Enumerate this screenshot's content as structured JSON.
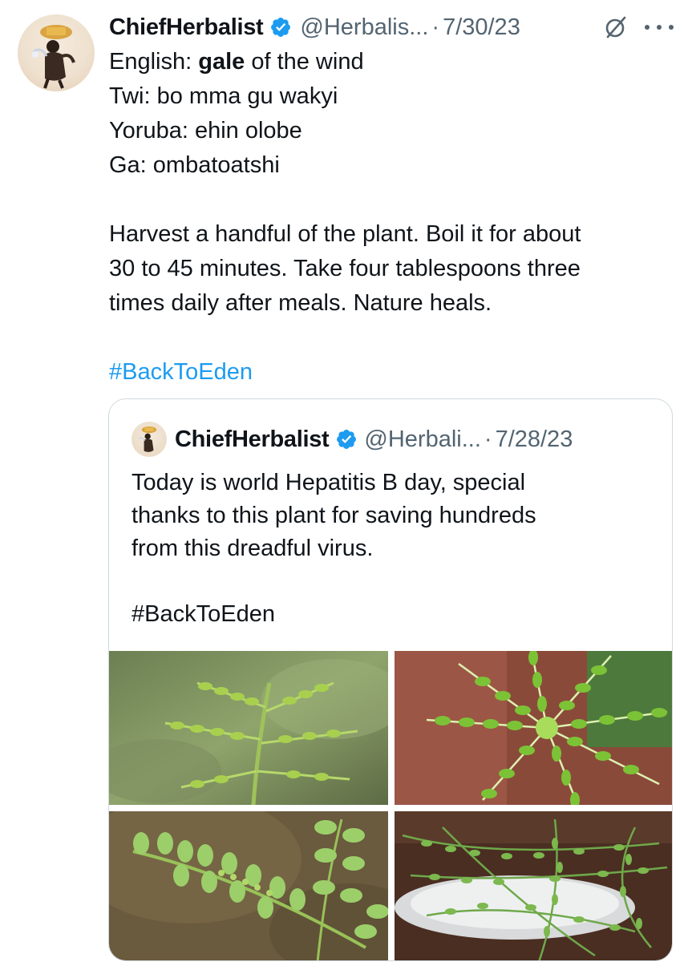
{
  "tweet": {
    "name": "ChiefHerbalist",
    "handle": "@Herbalis...",
    "separator": "·",
    "date": "7/30/23",
    "lines": [
      {
        "prefix": "English: ",
        "bold": "gale",
        "suffix": " of the wind"
      },
      "Twi: bo mma gu wakyi",
      "Yoruba: ehin olobe",
      "Ga: ombatoatshi",
      "",
      "Harvest a handful of the plant. Boil it for about",
      "30 to 45 minutes. Take four tablespoons three",
      "times daily after meals.  Nature heals.",
      "",
      "#BackToEden"
    ]
  },
  "quote": {
    "name": "ChiefHerbalist",
    "handle": "@Herbali...",
    "separator": "·",
    "date": "7/28/23",
    "lines": [
      "Today is world Hepatitis B day, special",
      "thanks to this plant for saving hundreds",
      "from this dreadful virus.",
      "",
      "#BackToEden"
    ],
    "images": [
      "plant-photo-1",
      "plant-photo-2",
      "plant-photo-3",
      "plant-photo-4"
    ]
  },
  "colors": {
    "text": "#0f1419",
    "secondary": "#536471",
    "link": "#1d9bf0",
    "verified": "#1d9bf0",
    "border": "#cfd9de"
  }
}
